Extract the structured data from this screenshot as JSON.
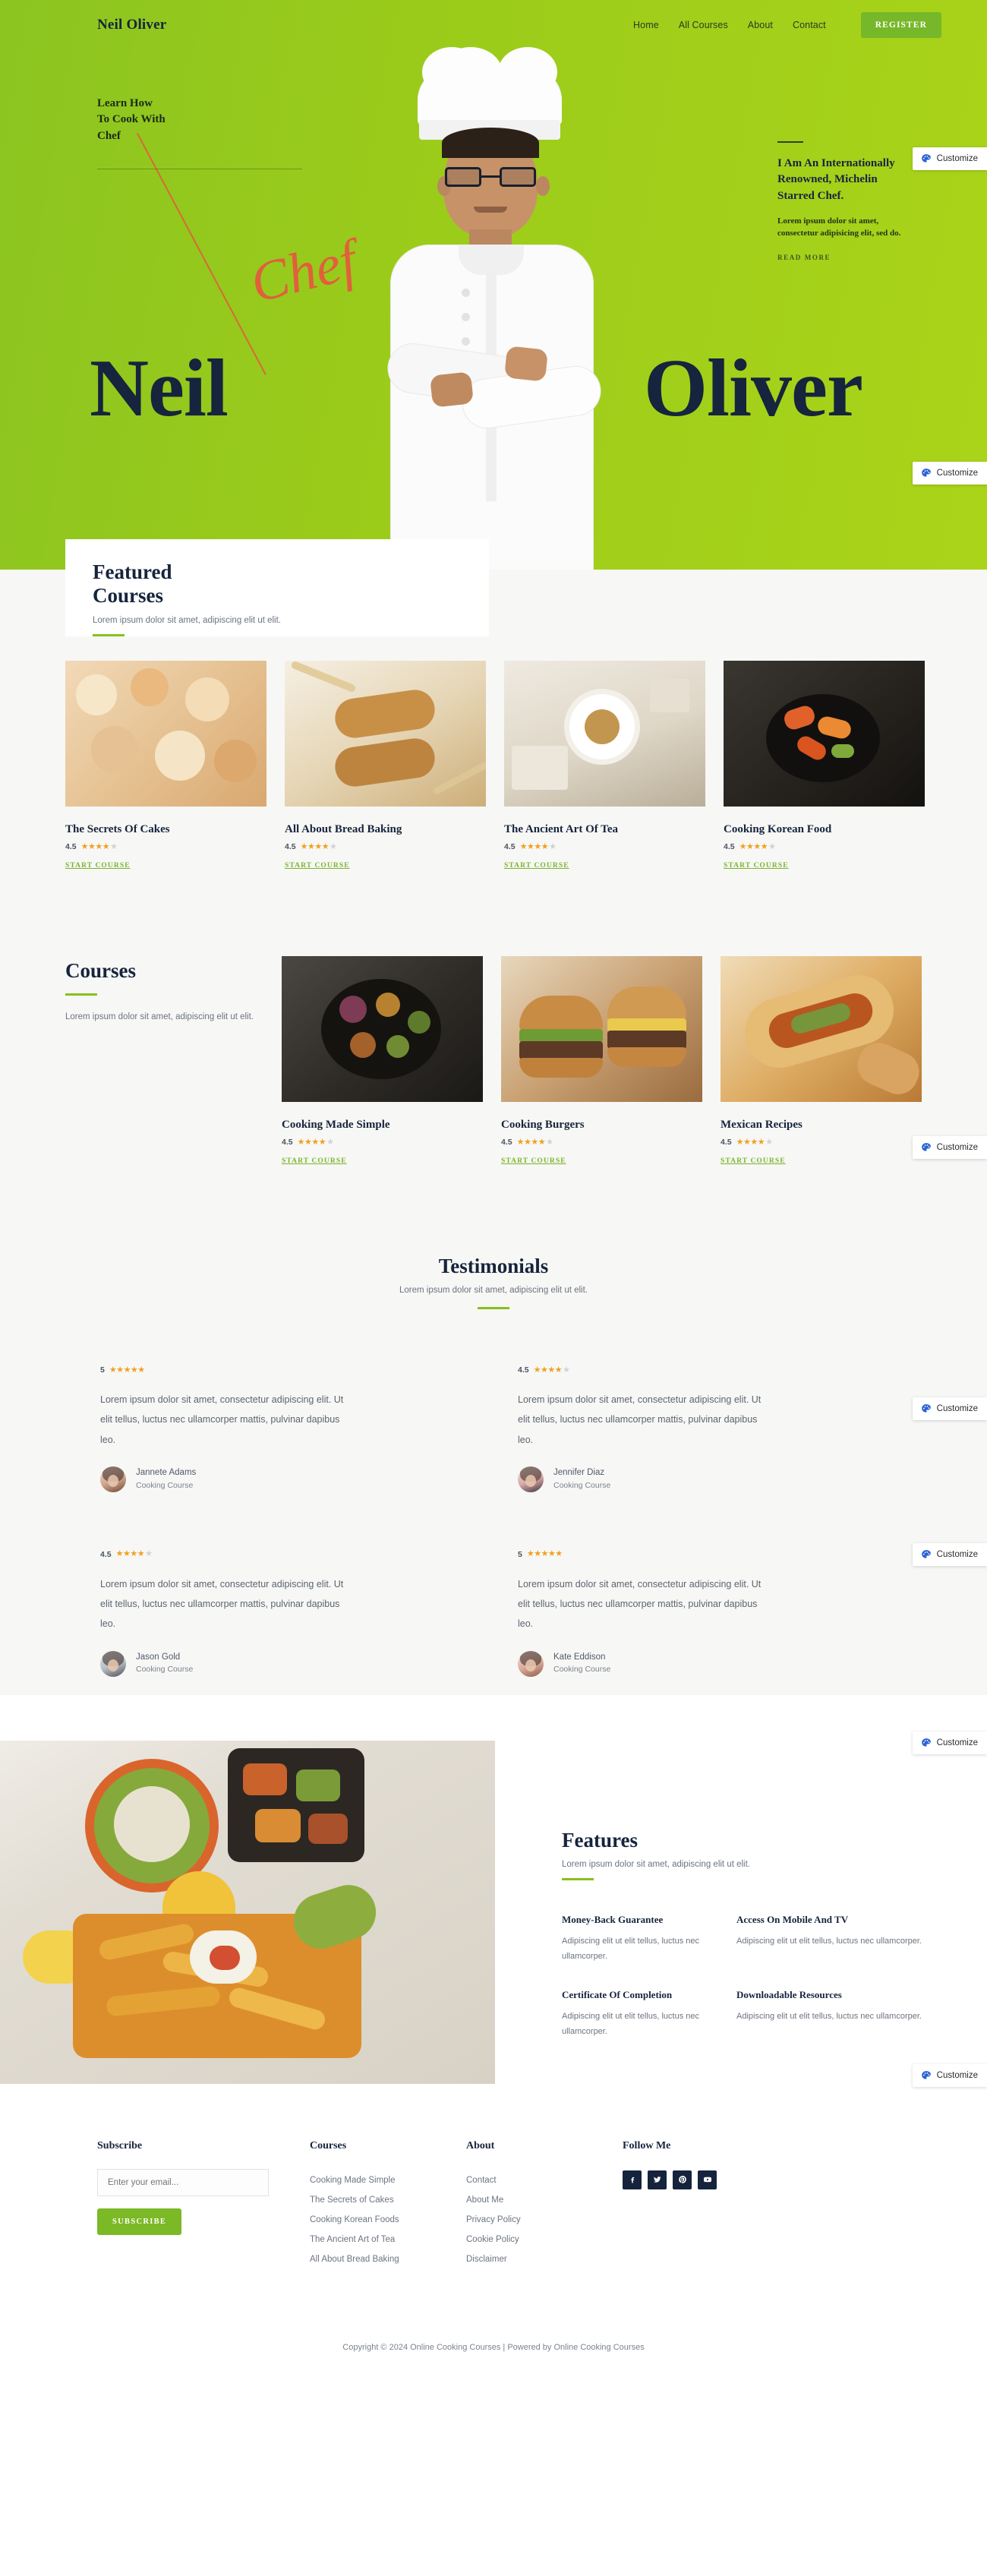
{
  "header": {
    "brand": "Neil Oliver",
    "nav": [
      {
        "label": "Home"
      },
      {
        "label": "All Courses"
      },
      {
        "label": "About"
      },
      {
        "label": "Contact"
      }
    ],
    "register_label": "REGISTER"
  },
  "hero": {
    "kicker": "Learn How\nTo Cook With\nChef",
    "first_name": "Neil",
    "last_name": "Oliver",
    "script_word": "Chef",
    "right_title": "I Am An Internationally Renowned, Michelin Starred Chef.",
    "right_desc": "Lorem ipsum dolor sit amet, consectetur adipisicing elit, sed do.",
    "read_more": "READ MORE"
  },
  "customize": {
    "label": "Customize",
    "icon": "palette-icon",
    "accent": "#2a62d6"
  },
  "featured": {
    "title": "Featured\nCourses",
    "desc": "Lorem ipsum dolor sit amet, adipiscing elit ut elit.",
    "cards": [
      {
        "title": "The Secrets Of Cakes",
        "rating": "4.5",
        "cta": "START COURSE",
        "image": "canapes-platter"
      },
      {
        "title": "All About Bread Baking",
        "rating": "4.5",
        "cta": "START COURSE",
        "image": "bread-loaves"
      },
      {
        "title": "The Ancient Art Of Tea",
        "rating": "4.5",
        "cta": "START COURSE",
        "image": "tea-cup-book"
      },
      {
        "title": "Cooking Korean Food",
        "rating": "4.5",
        "cta": "START COURSE",
        "image": "korean-bowl"
      }
    ]
  },
  "courses": {
    "title": "Courses",
    "desc": "Lorem ipsum dolor sit amet, adipiscing elit ut elit.",
    "cards": [
      {
        "title": "Cooking Made Simple",
        "rating": "4.5",
        "cta": "START COURSE",
        "image": "skillet-vegetables"
      },
      {
        "title": "Cooking Burgers",
        "rating": "4.5",
        "cta": "START COURSE",
        "image": "burgers"
      },
      {
        "title": "Mexican Recipes",
        "rating": "4.5",
        "cta": "START COURSE",
        "image": "burrito"
      }
    ]
  },
  "testimonials": {
    "title": "Testimonials",
    "desc": "Lorem ipsum dolor sit amet, adipiscing elit ut elit.",
    "items": [
      {
        "rating": "5",
        "stars_full": 5,
        "text": "Lorem ipsum dolor sit amet, consectetur adipiscing elit. Ut elit tellus, luctus nec ullamcorper mattis, pulvinar dapibus leo.",
        "name": "Jannete Adams",
        "role": "Cooking Course"
      },
      {
        "rating": "4.5",
        "stars_full": 4,
        "text": "Lorem ipsum dolor sit amet, consectetur adipiscing elit. Ut elit tellus, luctus nec ullamcorper mattis, pulvinar dapibus leo.",
        "name": "Jennifer Diaz",
        "role": "Cooking Course"
      },
      {
        "rating": "4.5",
        "stars_full": 4,
        "text": "Lorem ipsum dolor sit amet, consectetur adipiscing elit. Ut elit tellus, luctus nec ullamcorper mattis, pulvinar dapibus leo.",
        "name": "Jason Gold",
        "role": "Cooking Course"
      },
      {
        "rating": "5",
        "stars_full": 5,
        "text": "Lorem ipsum dolor sit amet, consectetur adipiscing elit. Ut elit tellus, luctus nec ullamcorper mattis, pulvinar dapibus leo.",
        "name": "Kate Eddison",
        "role": "Cooking Course"
      }
    ]
  },
  "features": {
    "title": "Features",
    "desc": "Lorem ipsum dolor sit amet, adipiscing elit ut elit.",
    "image": "salad-and-fries-table",
    "items": [
      {
        "title": "Money-Back Guarantee",
        "desc": "Adipiscing elit ut elit tellus, luctus nec ullamcorper."
      },
      {
        "title": "Access On Mobile And TV",
        "desc": "Adipiscing elit ut elit tellus, luctus nec ullamcorper."
      },
      {
        "title": "Certificate Of Completion",
        "desc": "Adipiscing elit ut elit tellus, luctus nec ullamcorper."
      },
      {
        "title": "Downloadable Resources",
        "desc": "Adipiscing elit ut elit tellus, luctus nec ullamcorper."
      }
    ]
  },
  "footer": {
    "subscribe": {
      "heading": "Subscribe",
      "placeholder": "Enter your email...",
      "value": "",
      "button": "SUBSCRIBE"
    },
    "courses": {
      "heading": "Courses",
      "links": [
        "Cooking Made Simple",
        "The Secrets of Cakes",
        "Cooking Korean Foods",
        "The Ancient Art of Tea",
        "All About Bread Baking"
      ]
    },
    "about": {
      "heading": "About",
      "links": [
        "Contact",
        "About Me",
        "Privacy Policy",
        "Cookie Policy",
        "Disclaimer"
      ]
    },
    "social": {
      "heading": "Follow Me",
      "icons": [
        "facebook-icon",
        "twitter-icon",
        "pinterest-icon",
        "youtube-icon"
      ]
    },
    "copyright": "Copyright © 2024 Online Cooking Courses | Powered by Online Cooking Courses"
  },
  "colors": {
    "brand_green": "#9ccc1a",
    "button_green": "#76b829",
    "navy": "#16243d",
    "star": "#efa11e",
    "accent_red": "#e8573f"
  }
}
